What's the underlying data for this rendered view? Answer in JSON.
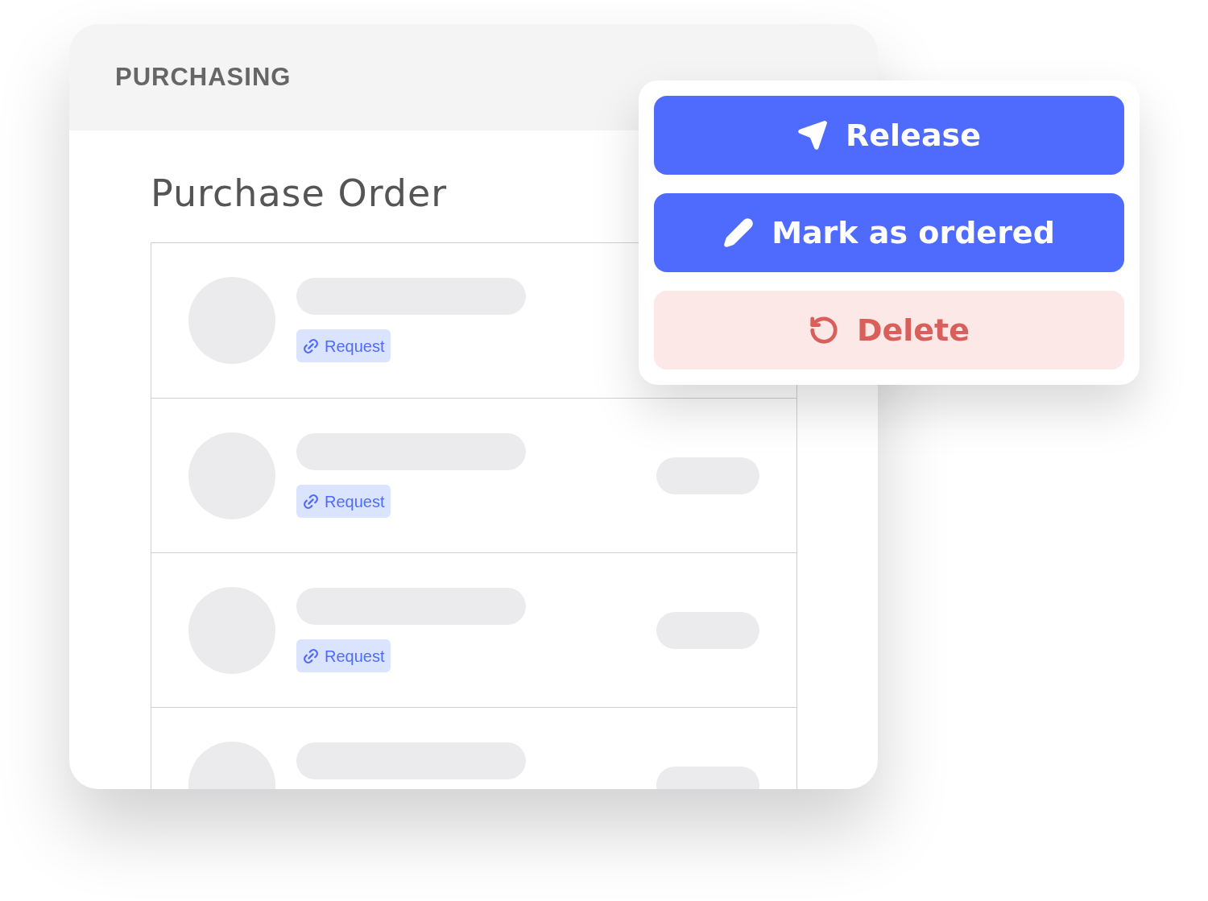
{
  "header": {
    "title": "PURCHASING"
  },
  "page": {
    "title": "Purchase Order"
  },
  "rows": [
    {
      "tag": "Request",
      "status_pill": false
    },
    {
      "tag": "Request",
      "status_pill": true
    },
    {
      "tag": "Request",
      "status_pill": true
    },
    {
      "status_pill": true
    }
  ],
  "actions": [
    {
      "label": "Release",
      "kind": "primary"
    },
    {
      "label": "Mark as ordered",
      "kind": "primary"
    },
    {
      "label": "Delete",
      "kind": "danger"
    }
  ]
}
